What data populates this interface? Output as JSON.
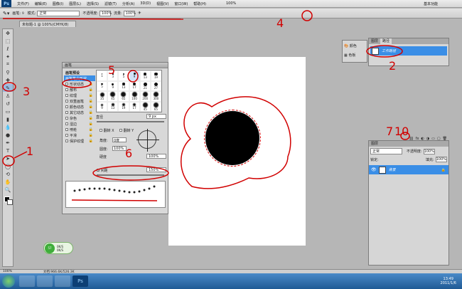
{
  "menubar": {
    "app_badge": "Ps",
    "items": [
      "文件(F)",
      "编辑(E)",
      "图像(I)",
      "图层(L)",
      "选择(S)",
      "滤镜(T)",
      "分析(A)",
      "3D(D)",
      "视图(V)",
      "窗口(W)",
      "帮助(H)"
    ],
    "zoom": "100%",
    "workspace": "基本功能"
  },
  "options": {
    "brush_label": "画笔:",
    "brush_size": "9",
    "mode_label": "模式:",
    "mode_value": "正常",
    "opacity_label": "不透明度:",
    "opacity_value": "100%",
    "flow_label": "流量:",
    "flow_value": "100%"
  },
  "doc_tab": "未标题-1 @ 100%(CMYK/8)",
  "brush_panel": {
    "title": "画笔",
    "presets_label": "画笔预设",
    "options": [
      "画笔笔尖形状",
      "形状动态",
      "散布",
      "纹理",
      "双重画笔",
      "颜色动态",
      "其它动态",
      "杂色",
      "湿边",
      "喷枪",
      "平滑",
      "保护纹理"
    ],
    "tip_sizes": [
      "1",
      "3",
      "5",
      "9",
      "13",
      "19",
      "5",
      "9",
      "13",
      "17",
      "21",
      "27",
      "35",
      "45",
      "65",
      "100",
      "200",
      "300",
      "9",
      "13",
      "19",
      "17",
      "45",
      "65"
    ],
    "diameter_label": "直径",
    "diameter_value": "9 px",
    "flip_x": "翻转 X",
    "flip_y": "翻转 Y",
    "angle_label": "角度:",
    "angle_value": "0度",
    "roundness_label": "圆度:",
    "roundness_value": "100%",
    "hardness_label": "硬度",
    "hardness_value": "100%",
    "spacing_label": "间距",
    "spacing_value": "150%"
  },
  "paths_panel": {
    "tabs": [
      "图层",
      "路径"
    ],
    "side_items": [
      "颜色",
      "色板"
    ],
    "path_name": "工作路径"
  },
  "layers_panel": {
    "tab": "图层",
    "blend_mode": "正常",
    "opacity_label": "不透明度:",
    "opacity_value": "100%",
    "lock_label": "锁定:",
    "fill_label": "填充:",
    "fill_value": "100%",
    "layer_name": "背景"
  },
  "annotations": [
    "1",
    "2",
    "3",
    "4",
    "5",
    "6",
    "7",
    "10"
  ],
  "status": {
    "zoom": "100%",
    "doc_info": "文档:966.6K/526.3K"
  },
  "taskbar": {
    "time": "13:49",
    "date": "2011/1/6"
  },
  "net_widget": {
    "up": "0K/S",
    "down": "0K/S",
    "percent": "57"
  },
  "colors": {
    "annotation": "#e00000",
    "selection_blue": "#3a8ee6",
    "taskbar": "#2b6cad"
  }
}
